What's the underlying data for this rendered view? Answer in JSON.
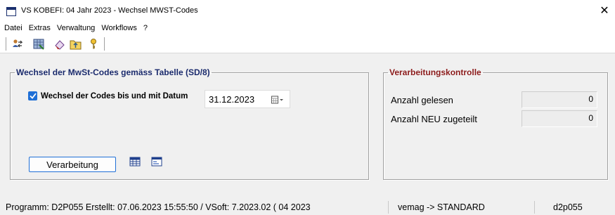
{
  "window": {
    "title": "VS KOBEFI: 04 Jahr 2023  -  Wechsel MWST-Codes",
    "close_glyph": "✕"
  },
  "menu": [
    "Datei",
    "Extras",
    "Verwaltung",
    "Workflows",
    "?"
  ],
  "toolbar": {
    "icons": [
      "people-transfer-icon",
      "database-table-icon",
      "eraser-icon",
      "folder-up-icon",
      "help-key-icon"
    ]
  },
  "group_left": {
    "legend": "Wechsel der MwSt-Codes gemäss Tabelle (SD/8)",
    "checkbox_label": "Wechsel der Codes bis und mit Datum",
    "checkbox_checked": true,
    "date_value": "31.12.2023",
    "run_button": "Verarbeitung"
  },
  "group_right": {
    "legend": "Verarbeitungskontrolle",
    "rows": [
      {
        "label": "Anzahl gelesen",
        "value": "0"
      },
      {
        "label": "Anzahl NEU zugeteilt",
        "value": "0"
      }
    ]
  },
  "status": {
    "program": "Programm: D2P055 Erstellt: 07.06.2023 15:55:50  / VSoft: 7.2023.02 ( 04 2023",
    "user": "vemag -> STANDARD",
    "code": "d2p055"
  },
  "colors": {
    "legend_left": "#1a2a6c",
    "legend_right": "#8b1a1a",
    "accent": "#1f6fd6"
  }
}
